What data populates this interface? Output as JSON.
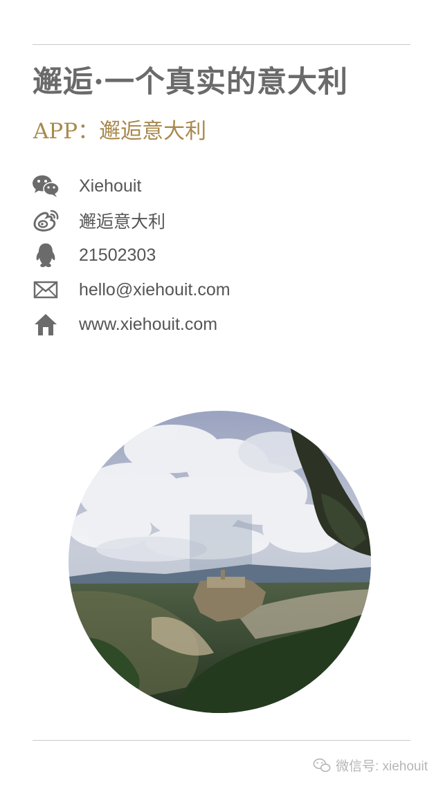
{
  "header": {
    "title": "邂逅·一个真实的意大利",
    "subtitle": "APP：邂逅意大利"
  },
  "contacts": [
    {
      "icon": "wechat-icon",
      "text": "Xiehouit"
    },
    {
      "icon": "weibo-icon",
      "text": "邂逅意大利"
    },
    {
      "icon": "qq-icon",
      "text": "21502303"
    },
    {
      "icon": "mail-icon",
      "text": "hello@xiehouit.com"
    },
    {
      "icon": "home-icon",
      "text": "www.xiehouit.com"
    }
  ],
  "footer": {
    "icon": "wechat-icon",
    "text": "微信号: xiehouit"
  },
  "colors": {
    "title": "#6a6a6a",
    "subtitle": "#a8894e",
    "icon": "#6b6b6b",
    "text": "#555555",
    "rule": "#c9c9c9",
    "footer": "#b5b5b5"
  }
}
